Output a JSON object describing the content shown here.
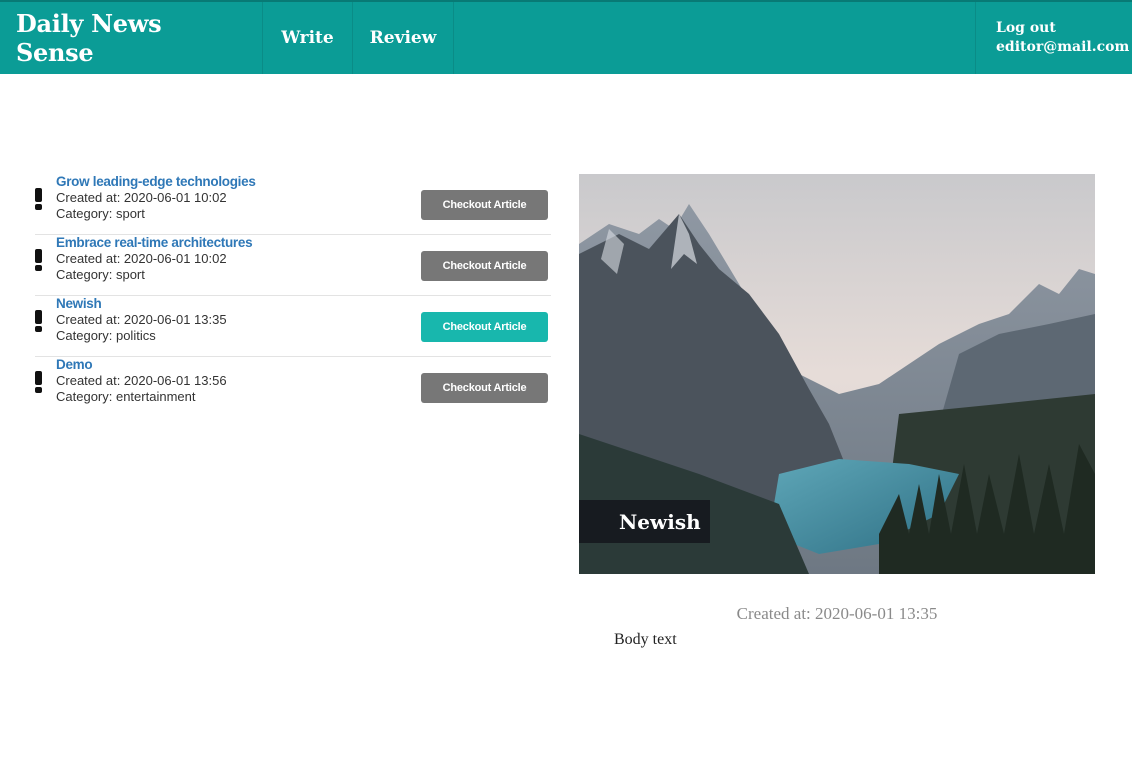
{
  "header": {
    "brand": "Daily News Sense",
    "nav": {
      "write": "Write",
      "review": "Review"
    },
    "account": {
      "logout": "Log out",
      "email": "editor@mail.com"
    },
    "color": "#0b9c96"
  },
  "articles": [
    {
      "title": "Grow leading-edge technologies",
      "created": "Created at: 2020-06-01 10:02",
      "category": "Category: sport",
      "button": "Checkout Article",
      "active": false
    },
    {
      "title": "Embrace real-time architectures",
      "created": "Created at: 2020-06-01 10:02",
      "category": "Category: sport",
      "button": "Checkout Article",
      "active": false
    },
    {
      "title": "Newish",
      "created": "Created at: 2020-06-01 13:35",
      "category": "Category: politics",
      "button": "Checkout Article",
      "active": true
    },
    {
      "title": "Demo",
      "created": "Created at: 2020-06-01 13:56",
      "category": "Category: entertainment",
      "button": "Checkout Article",
      "active": false
    }
  ],
  "preview": {
    "title": "Newish",
    "created": "Created at: 2020-06-01 13:35",
    "body": "Body text"
  },
  "colors": {
    "active_button": "#18b7ad",
    "inactive_button": "#777777",
    "link": "#2f78b7"
  }
}
